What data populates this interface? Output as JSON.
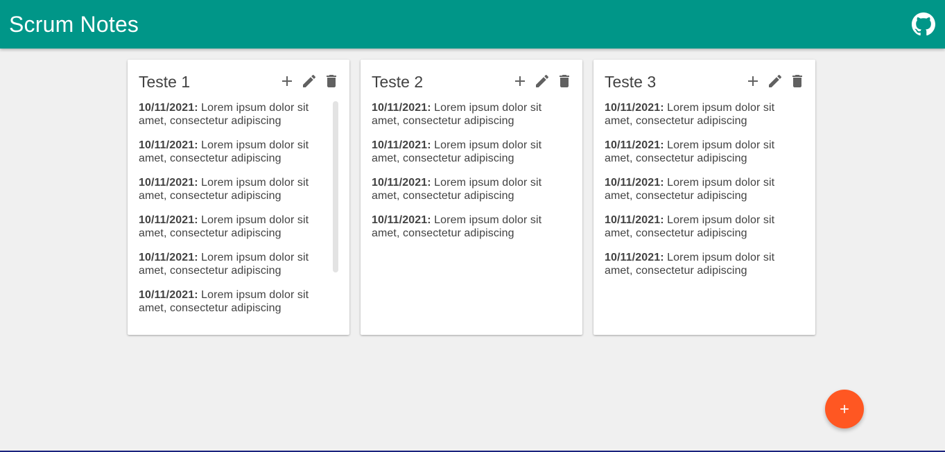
{
  "app": {
    "title": "Scrum Notes",
    "github_icon": "github-icon",
    "primary_color": "#009688",
    "fab_color": "#ff5722"
  },
  "columns": [
    {
      "title": "Teste 1",
      "notes": [
        {
          "date": "10/11/2021:",
          "text": " Lorem ipsum dolor sit amet, consectetur adipiscing"
        },
        {
          "date": "10/11/2021:",
          "text": " Lorem ipsum dolor sit amet, consectetur adipiscing"
        },
        {
          "date": "10/11/2021:",
          "text": " Lorem ipsum dolor sit amet, consectetur adipiscing"
        },
        {
          "date": "10/11/2021:",
          "text": " Lorem ipsum dolor sit amet, consectetur adipiscing"
        },
        {
          "date": "10/11/2021:",
          "text": " Lorem ipsum dolor sit amet, consectetur adipiscing"
        },
        {
          "date": "10/11/2021:",
          "text": " Lorem ipsum dolor sit amet, consectetur adipiscing"
        }
      ]
    },
    {
      "title": "Teste 2",
      "notes": [
        {
          "date": "10/11/2021:",
          "text": " Lorem ipsum dolor sit amet, consectetur adipiscing"
        },
        {
          "date": "10/11/2021:",
          "text": " Lorem ipsum dolor sit amet, consectetur adipiscing"
        },
        {
          "date": "10/11/2021:",
          "text": " Lorem ipsum dolor sit amet, consectetur adipiscing"
        },
        {
          "date": "10/11/2021:",
          "text": " Lorem ipsum dolor sit amet, consectetur adipiscing"
        }
      ]
    },
    {
      "title": "Teste 3",
      "notes": [
        {
          "date": "10/11/2021:",
          "text": " Lorem ipsum dolor sit amet, consectetur adipiscing"
        },
        {
          "date": "10/11/2021:",
          "text": " Lorem ipsum dolor sit amet, consectetur adipiscing"
        },
        {
          "date": "10/11/2021:",
          "text": " Lorem ipsum dolor sit amet, consectetur adipiscing"
        },
        {
          "date": "10/11/2021:",
          "text": " Lorem ipsum dolor sit amet, consectetur adipiscing"
        },
        {
          "date": "10/11/2021:",
          "text": " Lorem ipsum dolor sit amet, consectetur adipiscing"
        }
      ]
    }
  ],
  "card_icons": [
    "plus-icon",
    "pencil-icon",
    "trash-icon"
  ],
  "fab_icon": "plus-icon"
}
